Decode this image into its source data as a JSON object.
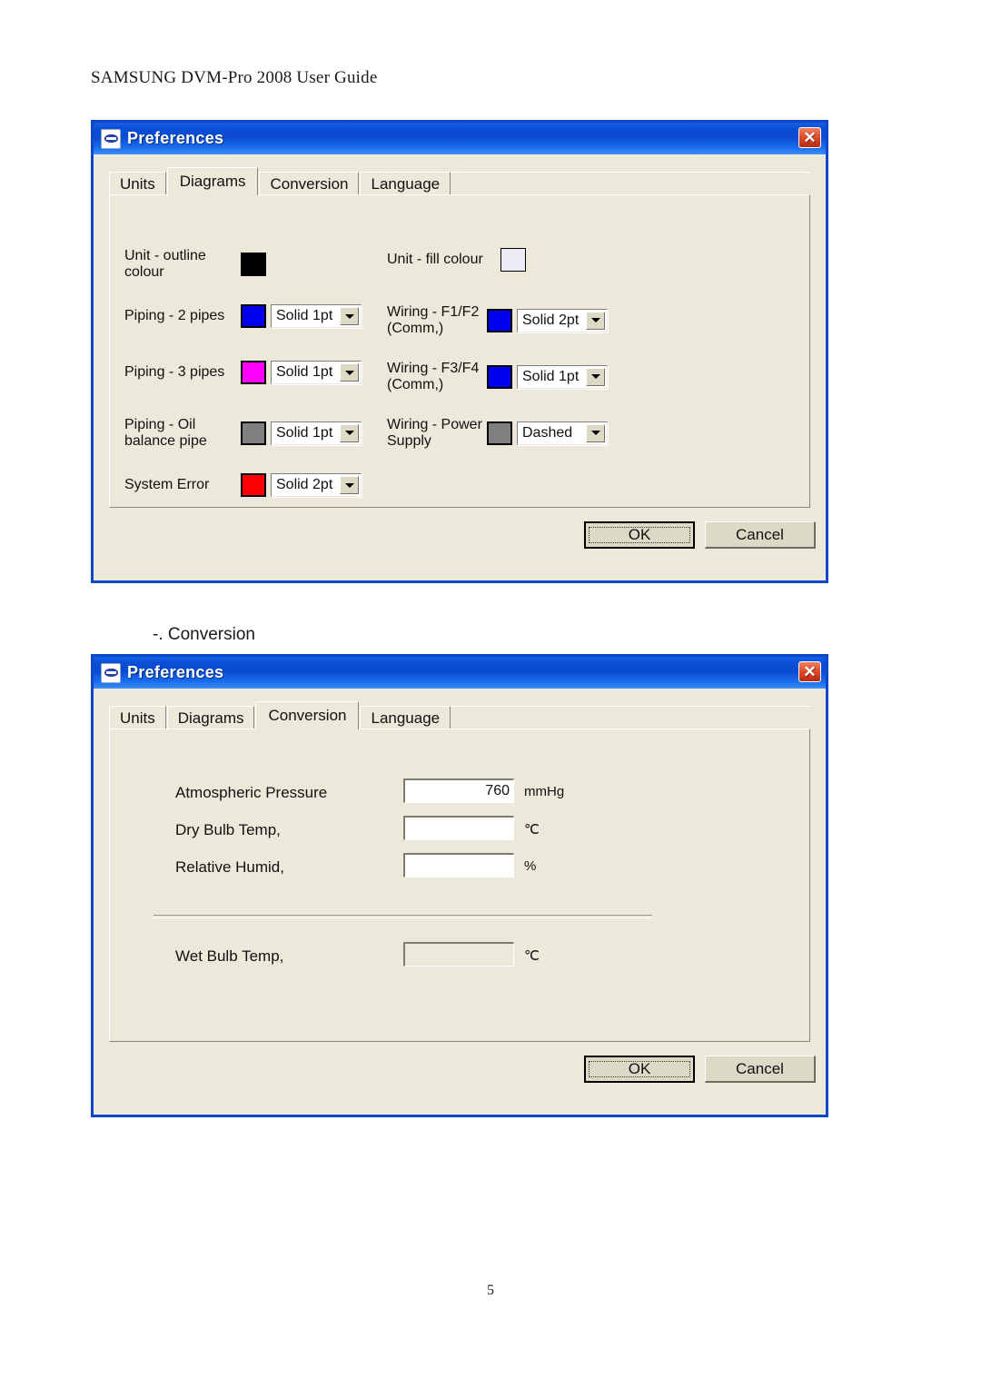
{
  "document": {
    "header": "SAMSUNG DVM-Pro 2008 User Guide",
    "page_number": "5",
    "section_caption": "-. Conversion"
  },
  "dialog_diagrams": {
    "title": "Preferences",
    "icon": "dvm-app-icon",
    "close_label": "✕",
    "tabs": [
      {
        "label": "Units",
        "active": false
      },
      {
        "label": "Diagrams",
        "active": true
      },
      {
        "label": "Conversion",
        "active": false
      },
      {
        "label": "Language",
        "active": false
      }
    ],
    "rows": {
      "unit_outline": {
        "label": "Unit - outline\ncolour",
        "swatch_color": "#000000"
      },
      "unit_fill": {
        "label": "Unit - fill colour",
        "swatch_color": "#ECECF6"
      },
      "piping_2pipes": {
        "label": "Piping - 2 pipes",
        "swatch_color": "#0000EE",
        "style": "Solid 1pt"
      },
      "wiring_f1f2": {
        "label": "Wiring - F1/F2\n(Comm,)",
        "swatch_color": "#0000EE",
        "style": "Solid 2pt"
      },
      "piping_3pipes": {
        "label": "Piping - 3 pipes",
        "swatch_color": "#FF00FF",
        "style": "Solid 1pt"
      },
      "wiring_f3f4": {
        "label": "Wiring - F3/F4\n(Comm,)",
        "swatch_color": "#0000EE",
        "style": "Solid 1pt"
      },
      "piping_oil": {
        "label": "Piping - Oil\nbalance pipe",
        "swatch_color": "#808080",
        "style": "Solid 1pt"
      },
      "wiring_power": {
        "label": "Wiring - Power\nSupply",
        "swatch_color": "#808080",
        "style": "Dashed"
      },
      "system_error": {
        "label": "System Error",
        "swatch_color": "#FF0000",
        "style": "Solid 2pt"
      }
    },
    "buttons": {
      "ok": "OK",
      "cancel": "Cancel"
    }
  },
  "dialog_conversion": {
    "title": "Preferences",
    "icon": "dvm-app-icon",
    "close_label": "✕",
    "tabs": [
      {
        "label": "Units",
        "active": false
      },
      {
        "label": "Diagrams",
        "active": false
      },
      {
        "label": "Conversion",
        "active": true
      },
      {
        "label": "Language",
        "active": false
      }
    ],
    "fields": [
      {
        "label": "Atmospheric Pressure",
        "value": "760",
        "unit": "mmHg",
        "readonly": false
      },
      {
        "label": "Dry Bulb Temp,",
        "value": "",
        "unit": "℃",
        "readonly": false
      },
      {
        "label": "Relative Humid,",
        "value": "",
        "unit": "%",
        "readonly": false
      },
      {
        "label": "Wet Bulb Temp,",
        "value": "",
        "unit": "℃",
        "readonly": true
      }
    ],
    "buttons": {
      "ok": "OK",
      "cancel": "Cancel"
    }
  }
}
